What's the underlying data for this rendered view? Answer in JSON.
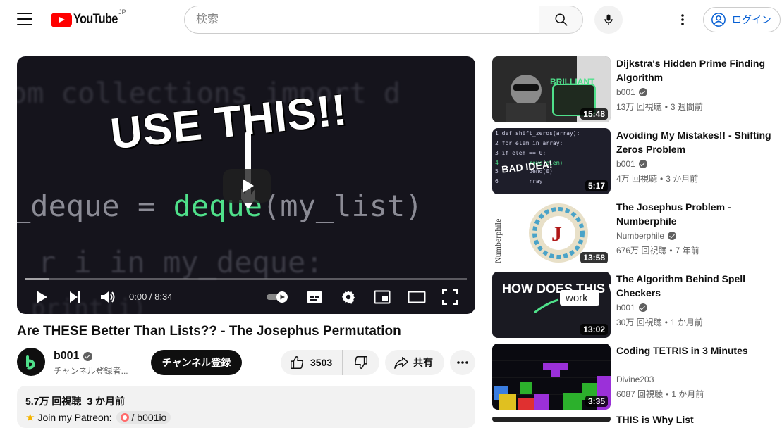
{
  "header": {
    "logo_text": "YouTube",
    "region": "JP",
    "search_placeholder": "検索",
    "login_label": "ログイン"
  },
  "player": {
    "overlay_title": "USE THIS!!",
    "code_lines": [
      "om collections import d",
      "_deque = ",
      "deque",
      "(my_list)",
      "r i in my_deque:",
      "print(i)"
    ],
    "time": "0:00 / 8:34",
    "progress_fraction": 0
  },
  "video": {
    "title": "Are THESE Better Than Lists?? - The Josephus Permutation",
    "channel": "b001",
    "subscribers": "チャンネル登録者...",
    "subscribe_label": "チャンネル登録",
    "likes": "3503",
    "share_label": "共有",
    "views": "5.7万 回視聴",
    "date": "3 か月前",
    "desc_line": "Join my Patreon:",
    "patreon_handle": "/ b001io"
  },
  "recommendations": [
    {
      "title": "Dijkstra's Hidden Prime Finding Algorithm",
      "channel": "b001",
      "verified": true,
      "views": "13万 回視聴",
      "age": "3 週間前",
      "duration": "15:48",
      "thumb_text": "BRILLIANT"
    },
    {
      "title": "Avoiding My Mistakes!! - Shifting Zeros Problem",
      "channel": "b001",
      "verified": true,
      "views": "4万 回視聴",
      "age": "3 か月前",
      "duration": "5:17",
      "thumb_text": "BAD IDEA!"
    },
    {
      "title": "The Josephus Problem - Numberphile",
      "channel": "Numberphile",
      "verified": true,
      "views": "676万 回視聴",
      "age": "7 年前",
      "duration": "13:58",
      "thumb_text": "Numberphile"
    },
    {
      "title": "The Algorithm Behind Spell Checkers",
      "channel": "b001",
      "verified": true,
      "views": "30万 回視聴",
      "age": "1 か月前",
      "duration": "13:02",
      "thumb_text": "HOW DOES THIS WERK?"
    },
    {
      "title": "Coding TETRIS in 3 Minutes",
      "channel": "Divine203",
      "verified": false,
      "views": "6087 回視聴",
      "age": "1 か月前",
      "duration": "3:35",
      "thumb_text": ""
    },
    {
      "title": "THIS is Why List",
      "channel": "",
      "verified": false,
      "views": "",
      "age": "",
      "duration": "",
      "thumb_text": ""
    }
  ],
  "colors": {
    "brand_red": "#ff0000",
    "link_blue": "#065fd4",
    "code_green": "#4fe08a"
  }
}
